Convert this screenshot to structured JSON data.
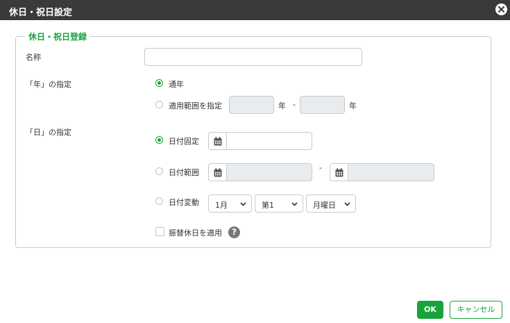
{
  "dialog": {
    "title": "休日・祝日設定",
    "close_icon": "close-icon"
  },
  "fieldset": {
    "legend": "休日・祝日登録"
  },
  "name_row": {
    "label": "名称",
    "value": "",
    "placeholder": ""
  },
  "year_spec": {
    "label": "「年」の指定",
    "options": [
      {
        "label": "通年",
        "selected": true
      },
      {
        "label": "適用範囲を指定",
        "selected": false
      }
    ],
    "from_value": "",
    "to_value": "",
    "unit": "年",
    "separator": "-"
  },
  "day_spec": {
    "label": "「日」の指定",
    "fixed_label": "日付固定",
    "range_label": "日付範囲",
    "range_separator": "-",
    "variable_label": "日付変動",
    "selected": "日付固定",
    "month_select": "1月",
    "week_select": "第1",
    "weekday_select": "月曜日"
  },
  "substitute": {
    "label": "振替休日を適用",
    "checked": false,
    "help_glyph": "?"
  },
  "buttons": {
    "ok_label": "OK",
    "cancel_label": "キャンセル"
  },
  "colors": {
    "accent": "#19a33b",
    "titlebar": "#3a3a3a",
    "disabled_input": "#e9ecef"
  }
}
